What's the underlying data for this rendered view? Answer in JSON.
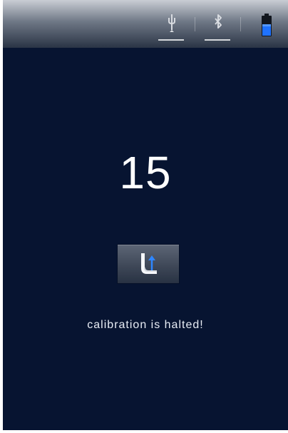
{
  "status_bar": {
    "icons": [
      "usb-icon",
      "bluetooth-icon",
      "battery-icon"
    ],
    "battery_color": "#1f72ff"
  },
  "main": {
    "counter": "15",
    "calibration_button_icon": "boot-up-arrow-icon",
    "status_text": "calibration is halted!"
  },
  "colors": {
    "background": "#071431",
    "accent_blue": "#2e86ff"
  }
}
